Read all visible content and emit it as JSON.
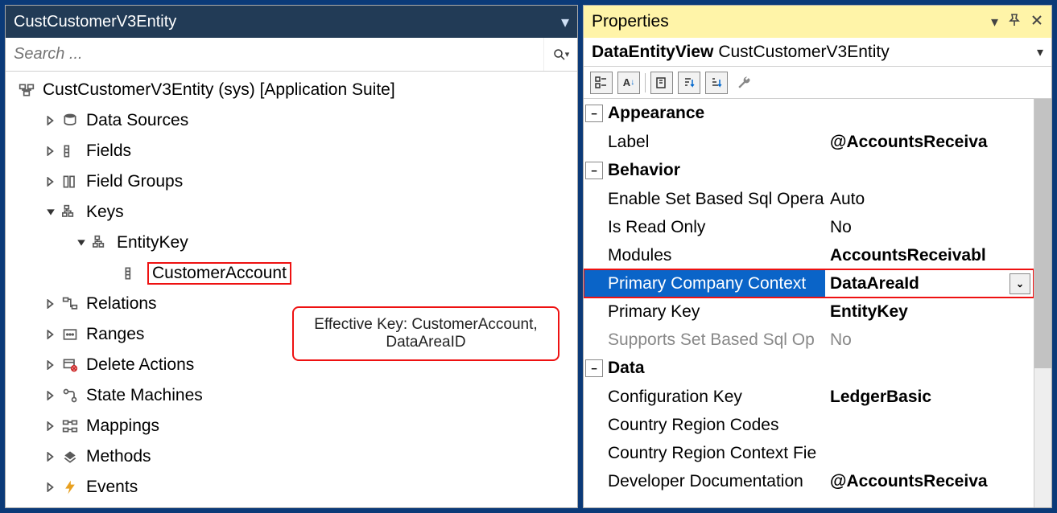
{
  "left": {
    "title": "CustCustomerV3Entity",
    "search_placeholder": "Search ...",
    "root": "CustCustomerV3Entity (sys) [Application Suite]",
    "nodes": {
      "datasources": "Data Sources",
      "fields": "Fields",
      "fieldgroups": "Field Groups",
      "keys": "Keys",
      "entitykey": "EntityKey",
      "customeraccount": "CustomerAccount",
      "relations": "Relations",
      "ranges": "Ranges",
      "deleteactions": "Delete Actions",
      "statemachines": "State Machines",
      "mappings": "Mappings",
      "methods": "Methods",
      "events": "Events"
    },
    "annotation_line1": "Effective Key: CustomerAccount,",
    "annotation_line2": "DataAreaID"
  },
  "right": {
    "panel_title": "Properties",
    "type_label": "DataEntityView",
    "object_name": "CustCustomerV3Entity",
    "categories": {
      "appearance": "Appearance",
      "behavior": "Behavior",
      "data": "Data"
    },
    "props": {
      "label_k": "Label",
      "label_v": "@AccountsReceiva",
      "esb_k": "Enable Set Based Sql Opera",
      "esb_v": "Auto",
      "readonly_k": "Is Read Only",
      "readonly_v": "No",
      "modules_k": "Modules",
      "modules_v": "AccountsReceivabl",
      "pcc_k": "Primary Company Context",
      "pcc_v": "DataAreaId",
      "pk_k": "Primary Key",
      "pk_v": "EntityKey",
      "ssb_k": "Supports Set Based Sql Op",
      "ssb_v": "No",
      "cfgkey_k": "Configuration Key",
      "cfgkey_v": "LedgerBasic",
      "crc_k": "Country Region Codes",
      "crc_v": "",
      "crcf_k": "Country Region Context Fie",
      "crcf_v": "",
      "devdoc_k": "Developer Documentation",
      "devdoc_v": "@AccountsReceiva"
    }
  }
}
